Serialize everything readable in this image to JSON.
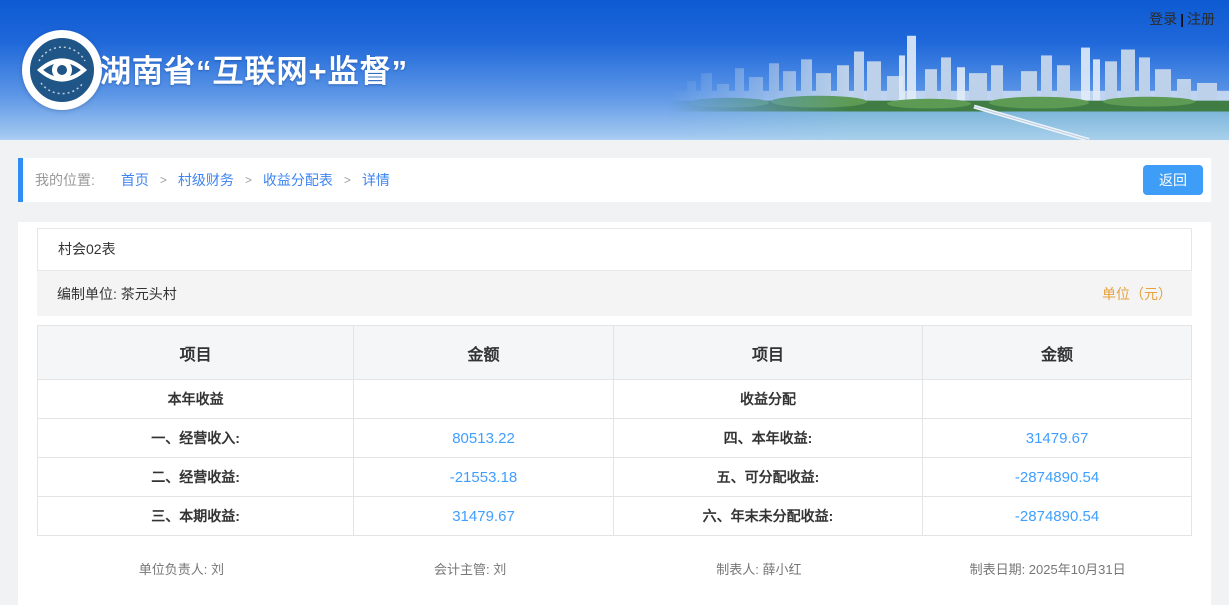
{
  "header": {
    "title": "湖南省“互联网+监督”",
    "login_label": "登录",
    "divider": "|",
    "register_label": "注册"
  },
  "breadcrumb": {
    "label": "我的位置:",
    "separator": ">",
    "items": [
      "首页",
      "村级财务",
      "收益分配表",
      "详情"
    ],
    "back_button": "返回"
  },
  "report": {
    "table_code": "村会02表",
    "prepared_by_label": "编制单位:",
    "prepared_by_value": "茶元头村",
    "unit_label": "单位（元）",
    "table": {
      "headers": [
        "项目",
        "金额",
        "项目",
        "金额"
      ],
      "rows": [
        [
          "本年收益",
          "",
          "收益分配",
          ""
        ],
        [
          "一、经营收入:",
          "80513.22",
          "四、本年收益:",
          "31479.67"
        ],
        [
          "二、经营收益:",
          "-21553.18",
          "五、可分配收益:",
          "-2874890.54"
        ],
        [
          "三、本期收益:",
          "31479.67",
          "六、年末未分配收益:",
          "-2874890.54"
        ]
      ]
    },
    "signatures": [
      "单位负责人: 刘",
      "会计主管: 刘",
      "制表人: 薛小红",
      "制表日期: 2025年10月31日"
    ]
  },
  "colors": {
    "primary_blue": "#409EFF",
    "link_blue": "#3d85f2",
    "warning_orange": "#E6A23C",
    "header_gradient_top": "#0d5ad2",
    "header_gradient_bottom": "#aecff3"
  }
}
